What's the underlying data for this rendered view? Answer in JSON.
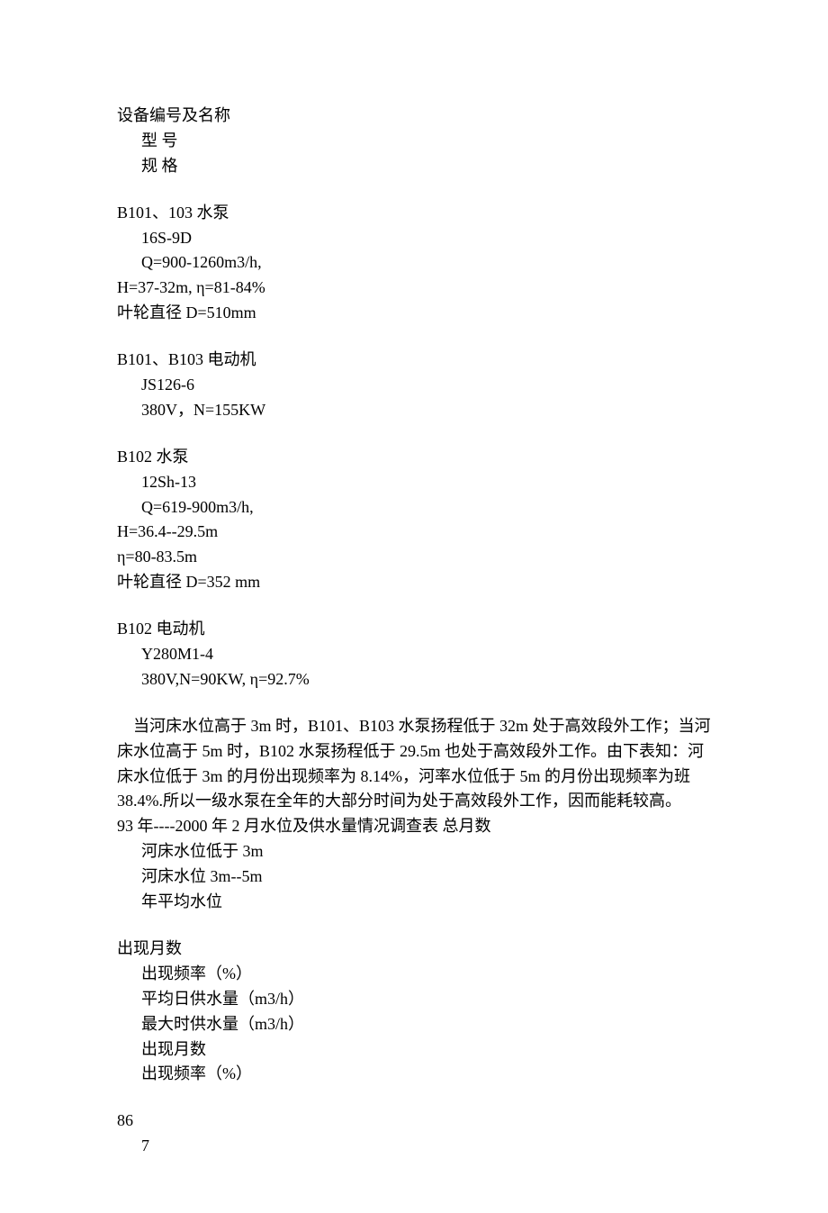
{
  "header": {
    "title": "设备编号及名称",
    "model_label": "型   号",
    "spec_label": "规  格"
  },
  "equipment": [
    {
      "name": "B101、103 水泵",
      "model": "16S-9D",
      "spec_lines": [
        "Q=900-1260m3/h,",
        "H=37-32m, η=81-84%",
        "叶轮直径 D=510mm"
      ]
    },
    {
      "name": "B101、B103 电动机",
      "model": "JS126-6",
      "spec_lines": [
        "380V，N=155KW"
      ]
    },
    {
      "name": "B102 水泵",
      "model": "12Sh-13",
      "spec_lines": [
        "Q=619-900m3/h,",
        "H=36.4--29.5m",
        "η=80-83.5m",
        "叶轮直径 D=352   mm"
      ]
    },
    {
      "name": "B102 电动机",
      "model": "Y280M1-4",
      "spec_lines": [
        "380V,N=90KW, η=92.7%"
      ]
    }
  ],
  "body_paragraph": "    当河床水位高于 3m 时，B101、B103 水泵扬程低于 32m 处于高效段外工作；当河床水位高于 5m 时，B102 水泵扬程低于 29.5m 也处于高效段外工作。由下表知：河床水位低于 3m 的月份出现频率为 8.14%，河率水位低于 5m 的月份出现频率为班 38.4%.所以一级水泵在全年的大部分时间为处于高效段外工作，因而能耗较高。",
  "survey_title": "93 年----2000 年 2 月水位及供水量情况调查表   总月数",
  "survey_rows_a": [
    "河床水位低于 3m",
    "河床水位 3m--5m",
    "年平均水位"
  ],
  "survey_header_b": "出现月数",
  "survey_rows_b": [
    "出现频率（%）",
    "平均日供水量（m3/h）",
    "最大时供水量（m3/h）",
    "出现月数",
    "出现频率（%）"
  ],
  "footer_values": {
    "v1": "86",
    "v2": "7"
  }
}
